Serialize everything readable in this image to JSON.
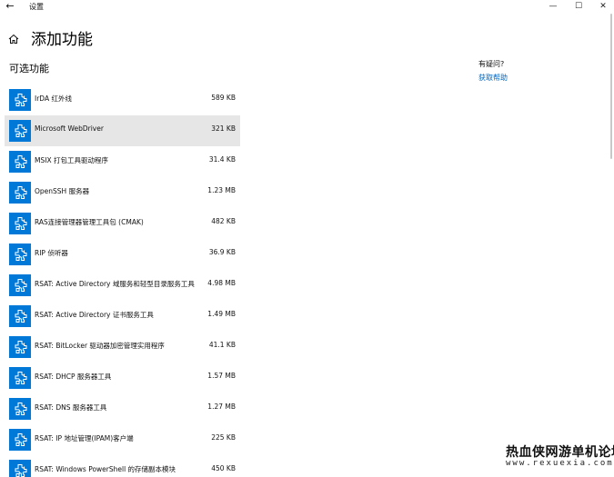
{
  "window": {
    "back_glyph": "←",
    "title": "设置",
    "minimize_glyph": "—",
    "maximize_glyph": "☐",
    "close_glyph": "✕"
  },
  "header": {
    "home_icon": "home-icon",
    "title": "添加功能"
  },
  "section": {
    "title": "可选功能"
  },
  "help": {
    "question": "有疑问?",
    "link": "获取帮助"
  },
  "features": [
    {
      "name": "IrDA 红外线",
      "size": "589 KB"
    },
    {
      "name": "Microsoft WebDriver",
      "size": "321 KB",
      "selected": true
    },
    {
      "name": "MSIX 打包工具驱动程序",
      "size": "31.4 KB"
    },
    {
      "name": "OpenSSH 服务器",
      "size": "1.23 MB"
    },
    {
      "name": "RAS连接管理器管理工具包 (CMAK)",
      "size": "482 KB"
    },
    {
      "name": "RIP 侦听器",
      "size": "36.9 KB"
    },
    {
      "name": "RSAT: Active Directory 域服务和轻型目录服务工具",
      "size": "4.98 MB"
    },
    {
      "name": "RSAT: Active Directory 证书服务工具",
      "size": "1.49 MB"
    },
    {
      "name": "RSAT: BitLocker 驱动器加密管理实用程序",
      "size": "41.1 KB"
    },
    {
      "name": "RSAT: DHCP 服务器工具",
      "size": "1.57 MB"
    },
    {
      "name": "RSAT: DNS 服务器工具",
      "size": "1.27 MB"
    },
    {
      "name": "RSAT: IP 地址管理(IPAM)客户端",
      "size": "225 KB"
    },
    {
      "name": "RSAT: Windows PowerShell 的存储副本模块",
      "size": "450 KB"
    }
  ],
  "feature_icon": "puzzle-piece-icon",
  "accent_color": "#0078d7",
  "link_color": "#0067c0",
  "watermark": {
    "text": "热血侠网游单机论坛",
    "url": "www.rexuexia.com"
  }
}
